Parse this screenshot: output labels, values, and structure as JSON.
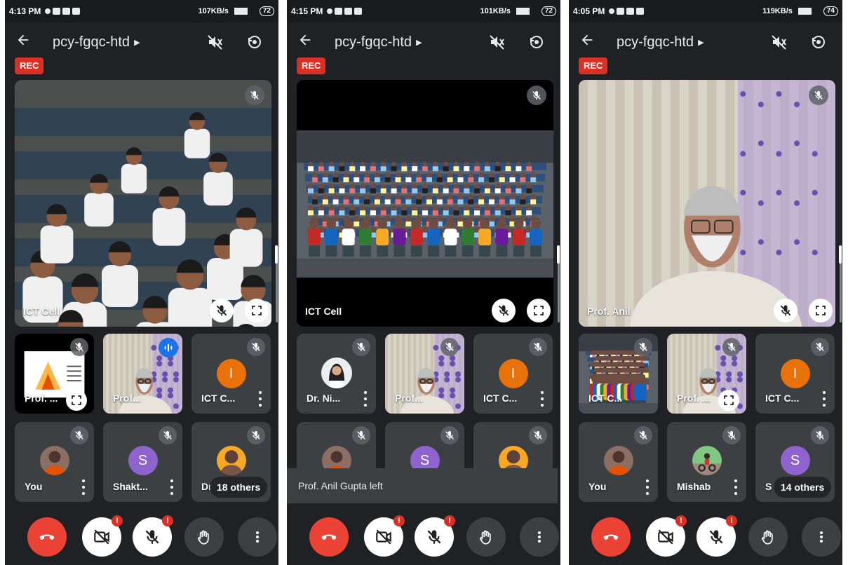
{
  "colors": {
    "background": "#202124",
    "tile": "#3c4043",
    "accent": "#1a73e8",
    "end_call": "#ea4335",
    "rec": "#d93025",
    "avatar_orange": "#e8710a",
    "avatar_purple": "#8e63ce"
  },
  "common": {
    "meeting_code": "pcy-fgqc-htd",
    "rec_label": "REC",
    "alert_glyph": "!"
  },
  "icons": [
    "back-arrow-icon",
    "speaker-off-icon",
    "camera-flip-icon",
    "mic-off-icon",
    "expand-icon",
    "more-vert-icon",
    "hand-raise-icon",
    "video-off-icon",
    "end-call-icon",
    "audio-wave-icon"
  ],
  "screens": [
    {
      "status": {
        "time": "4:13 PM",
        "speed": "107KB/s",
        "battery": "72"
      },
      "main": {
        "name": "ICT Cell"
      },
      "row1": [
        "Prof. ...",
        "Prof...",
        "ICT C..."
      ],
      "row1_avatar_letter": "I",
      "row2": [
        "You",
        "Shakt...",
        "Dr"
      ],
      "row2_avatar_letter": "S",
      "others": "18 others"
    },
    {
      "status": {
        "time": "4:15 PM",
        "speed": "101KB/s",
        "battery": "72"
      },
      "main": {
        "name": "ICT Cell"
      },
      "row1": [
        "Dr. Ni...",
        "Prof...",
        "ICT C..."
      ],
      "row1_avatar_letter": "I",
      "row2_avatar_letter": "S",
      "toast": "Prof. Anil Gupta left"
    },
    {
      "status": {
        "time": "4:05 PM",
        "speed": "119KB/s",
        "battery": "74"
      },
      "main": {
        "name": "Prof. Anil"
      },
      "row1": [
        "ICT C...",
        "Prof. ...",
        "ICT C..."
      ],
      "row1_avatar_letter": "I",
      "row2": [
        "You",
        "Mishab",
        "S"
      ],
      "row2_avatar_letter": "S",
      "others": "14 others"
    }
  ]
}
